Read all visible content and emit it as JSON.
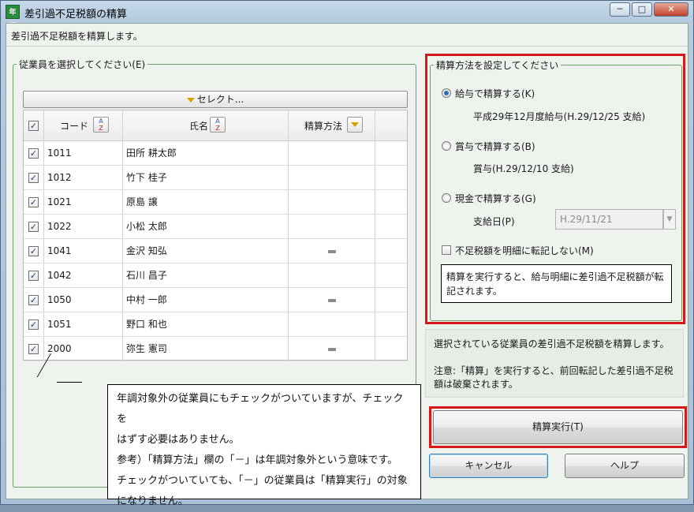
{
  "window": {
    "app_icon_text": "年調",
    "title": "差引過不足税額の精算",
    "minimize": "─",
    "maximize": "□",
    "close": "✕"
  },
  "description": "差引過不足税額を精算します。",
  "employee_group": {
    "legend": "従業員を選択してください(E)",
    "select_button": "セレクト...",
    "columns": {
      "code": "コード",
      "name": "氏名",
      "method": "精算方法"
    },
    "rows": [
      {
        "checked": true,
        "code": "1011",
        "name": "田所 耕太郎",
        "method": ""
      },
      {
        "checked": true,
        "code": "1012",
        "name": "竹下 桂子",
        "method": ""
      },
      {
        "checked": true,
        "code": "1021",
        "name": "原島 譲",
        "method": ""
      },
      {
        "checked": true,
        "code": "1022",
        "name": "小松 太郎",
        "method": ""
      },
      {
        "checked": true,
        "code": "1041",
        "name": "金沢 知弘",
        "method": "dash"
      },
      {
        "checked": true,
        "code": "1042",
        "name": "石川 昌子",
        "method": ""
      },
      {
        "checked": true,
        "code": "1050",
        "name": "中村 一郎",
        "method": "dash"
      },
      {
        "checked": true,
        "code": "1051",
        "name": "野口 和也",
        "method": ""
      },
      {
        "checked": true,
        "code": "2000",
        "name": "弥生 憲司",
        "method": "dash"
      }
    ]
  },
  "note": {
    "lines": [
      "年調対象外の従業員にもチェックがついていますが、チェックを",
      "はずす必要はありません。",
      "参考）「精算方法」欄の「－」は年調対象外という意味です。",
      "チェックがついていても、「－」の従業員は「精算実行」の対象",
      "になりません。"
    ]
  },
  "method_group": {
    "legend": "精算方法を設定してください",
    "option_salary": "給与で精算する(K)",
    "option_salary_detail": "平成29年12月度給与(H.29/12/25 支給)",
    "option_bonus": "賞与で精算する(B)",
    "option_bonus_detail": "賞与(H.29/12/10 支給)",
    "option_cash": "現金で精算する(G)",
    "payment_date_label": "支給日(P)",
    "payment_date_value": "H.29/11/21",
    "no_transfer_checkbox": "不足税額を明細に転記しない(M)",
    "info": "精算を実行すると、給与明細に差引過不足税額が転記されます。"
  },
  "message": {
    "line1": "選択されている従業員の差引過不足税額を精算します。",
    "line2": "注意:「精算」を実行すると、前回転記した差引過不足税額は破棄されます。"
  },
  "buttons": {
    "execute": "精算実行(T)",
    "cancel": "キャンセル",
    "help": "ヘルプ"
  },
  "colors": {
    "highlight": "#d4181c",
    "group_border": "#6aa06a"
  }
}
